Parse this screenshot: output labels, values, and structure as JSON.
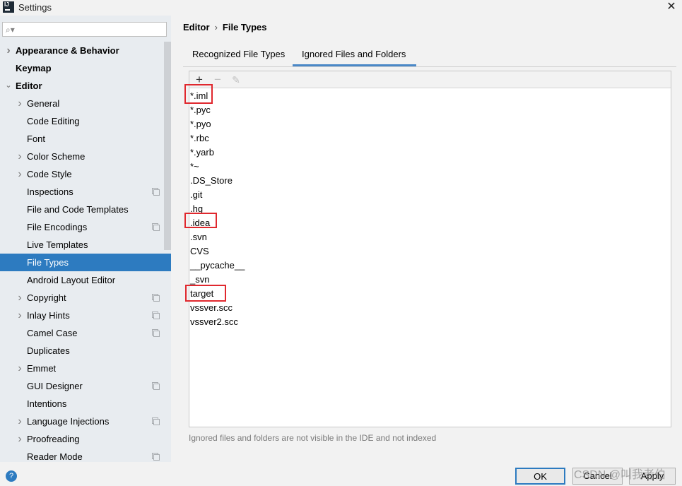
{
  "window": {
    "title": "Settings",
    "app_icon": "IJ"
  },
  "sidebar": {
    "search": {
      "value": "",
      "placeholder": ""
    },
    "items": [
      {
        "label": "Appearance & Behavior",
        "level": 0,
        "bold": true,
        "chevron": "right",
        "settings_icon": false
      },
      {
        "label": "Keymap",
        "level": 0,
        "bold": true,
        "chevron": "none",
        "settings_icon": false
      },
      {
        "label": "Editor",
        "level": 0,
        "bold": true,
        "chevron": "down",
        "settings_icon": false
      },
      {
        "label": "General",
        "level": 1,
        "chevron": "right",
        "settings_icon": false
      },
      {
        "label": "Code Editing",
        "level": 1,
        "chevron": "none",
        "settings_icon": false
      },
      {
        "label": "Font",
        "level": 1,
        "chevron": "none",
        "settings_icon": false
      },
      {
        "label": "Color Scheme",
        "level": 1,
        "chevron": "right",
        "settings_icon": false
      },
      {
        "label": "Code Style",
        "level": 1,
        "chevron": "right",
        "settings_icon": false
      },
      {
        "label": "Inspections",
        "level": 1,
        "chevron": "none",
        "settings_icon": true
      },
      {
        "label": "File and Code Templates",
        "level": 1,
        "chevron": "none",
        "settings_icon": false
      },
      {
        "label": "File Encodings",
        "level": 1,
        "chevron": "none",
        "settings_icon": true
      },
      {
        "label": "Live Templates",
        "level": 1,
        "chevron": "none",
        "settings_icon": false
      },
      {
        "label": "File Types",
        "level": 1,
        "chevron": "none",
        "settings_icon": false,
        "selected": true
      },
      {
        "label": "Android Layout Editor",
        "level": 1,
        "chevron": "none",
        "settings_icon": false
      },
      {
        "label": "Copyright",
        "level": 1,
        "chevron": "right",
        "settings_icon": true
      },
      {
        "label": "Inlay Hints",
        "level": 1,
        "chevron": "right",
        "settings_icon": true
      },
      {
        "label": "Camel Case",
        "level": 1,
        "chevron": "none",
        "settings_icon": true
      },
      {
        "label": "Duplicates",
        "level": 1,
        "chevron": "none",
        "settings_icon": false
      },
      {
        "label": "Emmet",
        "level": 1,
        "chevron": "right",
        "settings_icon": false
      },
      {
        "label": "GUI Designer",
        "level": 1,
        "chevron": "none",
        "settings_icon": true
      },
      {
        "label": "Intentions",
        "level": 1,
        "chevron": "none",
        "settings_icon": false
      },
      {
        "label": "Language Injections",
        "level": 1,
        "chevron": "right",
        "settings_icon": true
      },
      {
        "label": "Proofreading",
        "level": 1,
        "chevron": "right",
        "settings_icon": false
      },
      {
        "label": "Reader Mode",
        "level": 1,
        "chevron": "none",
        "settings_icon": true
      }
    ]
  },
  "breadcrumb": {
    "parent": "Editor",
    "separator": "›",
    "current": "File Types"
  },
  "tabs": [
    {
      "label": "Recognized File Types",
      "active": false
    },
    {
      "label": "Ignored Files and Folders",
      "active": true
    }
  ],
  "toolbar": {
    "add_icon": "+",
    "remove_icon": "−",
    "edit_icon": "✎"
  },
  "ignored_list": [
    "*.iml",
    "*.pyc",
    "*.pyo",
    "*.rbc",
    "*.yarb",
    "*~",
    ".DS_Store",
    ".git",
    ".hg",
    ".idea",
    ".svn",
    "CVS",
    "__pycache__",
    "_svn",
    "target",
    "vssver.scc",
    "vssver2.scc"
  ],
  "highlighted_entries": [
    "*.iml",
    ".idea",
    "target"
  ],
  "annotation_color": "#e0282e",
  "hint": "Ignored files and folders are not visible in the IDE and not indexed",
  "buttons": {
    "ok": "OK",
    "cancel": "Cancel",
    "apply": "Apply",
    "help": "?"
  },
  "watermark": "CSDN @叫我老伯",
  "colors": {
    "selection": "#2d7bc0",
    "tab_underline": "#4a88c7"
  }
}
